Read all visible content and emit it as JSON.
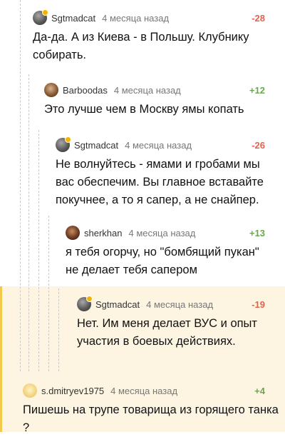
{
  "colors": {
    "negative_score": "#e0624d",
    "positive_score": "#6aa84f",
    "highlight_bg": "#fdf5e2",
    "highlight_bar": "#f2c94c"
  },
  "comments": [
    {
      "username": "Sgtmadcat",
      "time": "4 месяца назад",
      "score": "-28",
      "text": "Да-да. А из Киева - в Польшу. Клубнику собирать."
    },
    {
      "username": "Barboodas",
      "time": "4 месяца назад",
      "score": "+12",
      "text": "Это лучше чем в Москву ямы копать"
    },
    {
      "username": "Sgtmadcat",
      "time": "4 месяца назад",
      "score": "-26",
      "text": "Не волнуйтесь - ямами и гробами мы вас обеспечим. Вы главное вставайте покучнее, а то я сапер, а не снайпер."
    },
    {
      "username": "sherkhan",
      "time": "4 месяца назад",
      "score": "+13",
      "text": "я тебя огорчу, но \"бомбящий пукан\" не делает тебя сапером"
    },
    {
      "username": "Sgtmadcat",
      "time": "4 месяца назад",
      "score": "-19",
      "text": "Нет. Им меня делает ВУС и опыт участия в боевых действиях."
    },
    {
      "username": "s.dmitryev1975",
      "time": "4 месяца назад",
      "score": "+4",
      "text": "Пишешь на трупе товарища из горящего танка ?"
    }
  ]
}
